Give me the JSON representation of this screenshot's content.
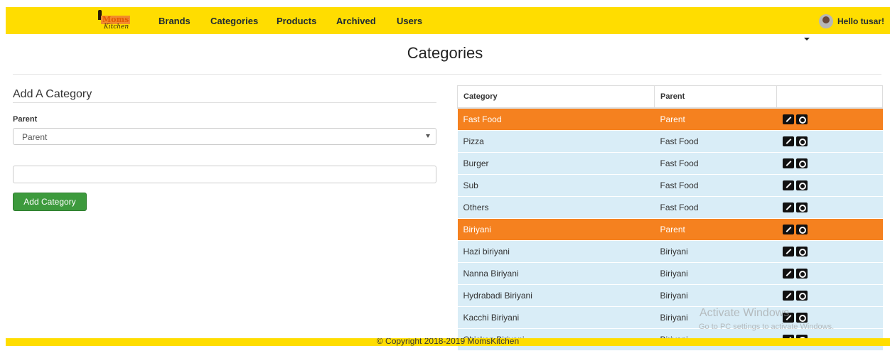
{
  "navbar": {
    "logo": {
      "top": "Moms",
      "bottom": "Kitchen"
    },
    "links": [
      "Brands",
      "Categories",
      "Products",
      "Archived",
      "Users"
    ],
    "user_greeting": "Hello tusar!"
  },
  "page": {
    "title": "Categories"
  },
  "form": {
    "section_title": "Add A Category",
    "parent_label": "Parent",
    "parent_select_value": "Parent",
    "name_input_value": "",
    "submit_label": "Add Category"
  },
  "table": {
    "headers": [
      "Category",
      "Parent",
      ""
    ],
    "rows": [
      {
        "category": "Fast Food",
        "parent": "Parent",
        "is_parent": true
      },
      {
        "category": "Pizza",
        "parent": "Fast Food",
        "is_parent": false
      },
      {
        "category": "Burger",
        "parent": "Fast Food",
        "is_parent": false
      },
      {
        "category": "Sub",
        "parent": "Fast Food",
        "is_parent": false
      },
      {
        "category": "Others",
        "parent": "Fast Food",
        "is_parent": false
      },
      {
        "category": "Biriyani",
        "parent": "Parent",
        "is_parent": true
      },
      {
        "category": "Hazi biriyani",
        "parent": "Biriyani",
        "is_parent": false
      },
      {
        "category": "Nanna Biriyani",
        "parent": "Biriyani",
        "is_parent": false
      },
      {
        "category": "Hydrabadi Biriyani",
        "parent": "Biriyani",
        "is_parent": false
      },
      {
        "category": "Kacchi Biriyani",
        "parent": "Biriyani",
        "is_parent": false
      },
      {
        "category": "Chicken Biriyani",
        "parent": "Biriyani",
        "is_parent": false
      }
    ]
  },
  "watermark": {
    "line1": "Activate Windows",
    "line2": "Go to PC settings to activate Windows."
  },
  "footer": {
    "text": "© Copyright 2018-2019 MomsKitchen"
  },
  "colors": {
    "navbar": "#ffdd00",
    "parent_row": "#f5811f",
    "child_row": "#d9edf7",
    "add_button": "#3d9a3d"
  }
}
